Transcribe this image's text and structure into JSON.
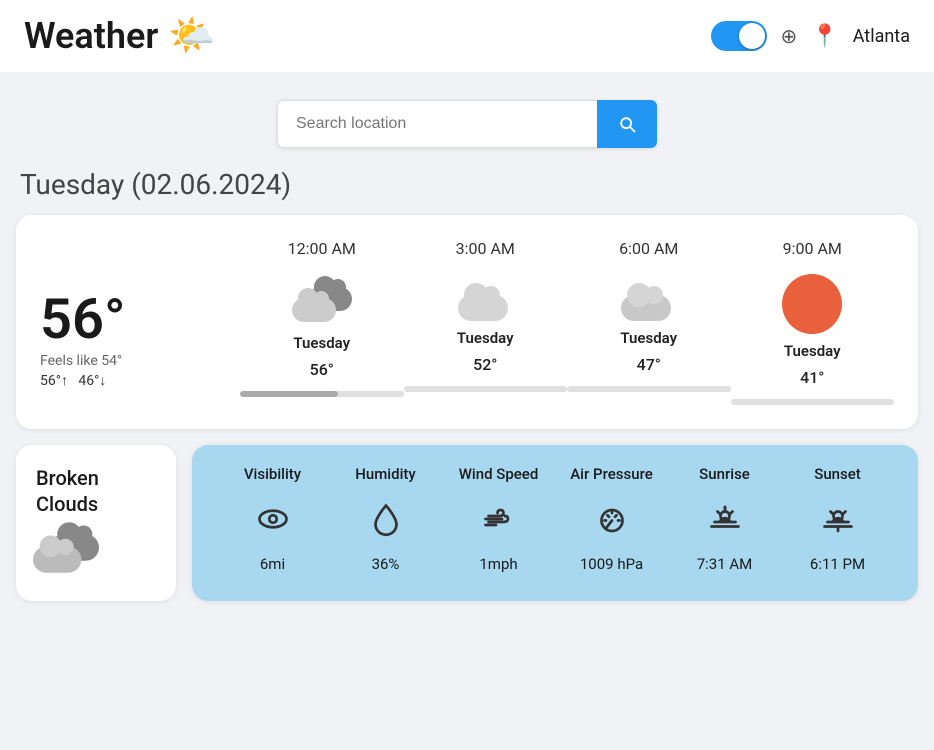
{
  "header": {
    "title": "Weather",
    "location": "Atlanta",
    "toggle_on": true
  },
  "search": {
    "placeholder": "Search location"
  },
  "day": {
    "label": "Tuesday",
    "date": "(02.06.2024)"
  },
  "current": {
    "temp": "56°",
    "feels_like": "Feels like 54°",
    "high": "56°",
    "low": "46°"
  },
  "hourly": [
    {
      "time": "12:00 AM",
      "day": "Tuesday",
      "temp": "56°",
      "type": "broken-clouds"
    },
    {
      "time": "3:00 AM",
      "day": "Tuesday",
      "temp": "52°",
      "type": "cloud"
    },
    {
      "time": "6:00 AM",
      "day": "Tuesday",
      "temp": "47°",
      "type": "cloud-light"
    },
    {
      "time": "9:00 AM",
      "day": "Tuesday",
      "temp": "41°",
      "type": "sun"
    }
  ],
  "condition": {
    "label": "Broken Clouds"
  },
  "stats": [
    {
      "label": "Visibility",
      "value": "6mi",
      "icon": "eye"
    },
    {
      "label": "Humidity",
      "value": "36%",
      "icon": "drop"
    },
    {
      "label": "Wind Speed",
      "value": "1mph",
      "icon": "wind"
    },
    {
      "label": "Air Pressure",
      "value": "1009 hPa",
      "icon": "gauge"
    },
    {
      "label": "Sunrise",
      "value": "7:31 AM",
      "icon": "sunrise"
    },
    {
      "label": "Sunset",
      "value": "6:11 PM",
      "icon": "sunset"
    }
  ]
}
